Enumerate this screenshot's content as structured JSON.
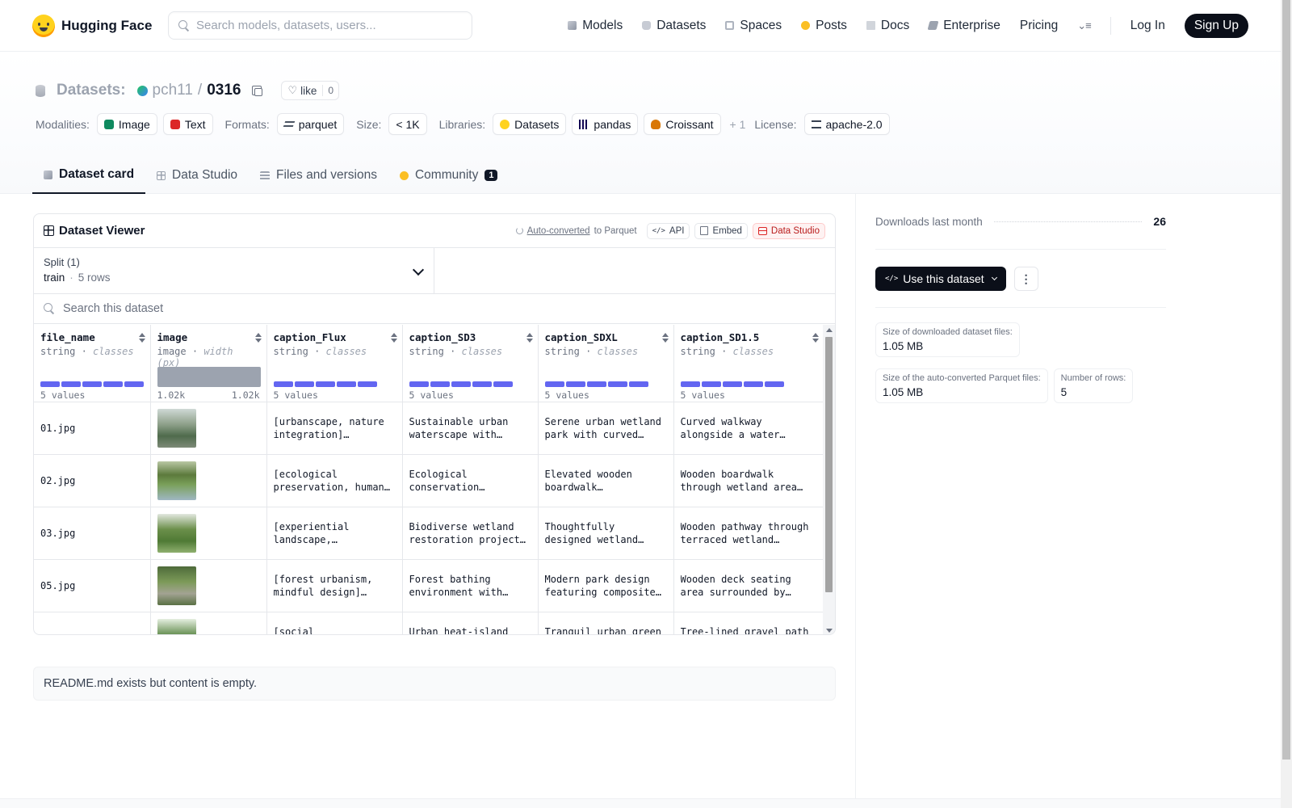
{
  "nav": {
    "brand": "Hugging Face",
    "search_placeholder": "Search models, datasets, users...",
    "links": [
      {
        "label": "Models",
        "icon": "models-icon"
      },
      {
        "label": "Datasets",
        "icon": "datasets-icon"
      },
      {
        "label": "Spaces",
        "icon": "spaces-icon"
      },
      {
        "label": "Posts",
        "icon": "posts-icon"
      },
      {
        "label": "Docs",
        "icon": "docs-icon"
      },
      {
        "label": "Enterprise",
        "icon": "enterprise-icon"
      },
      {
        "label": "Pricing"
      }
    ],
    "login": "Log In",
    "signup": "Sign Up"
  },
  "repo": {
    "type_label": "Datasets:",
    "owner": "pch11",
    "separator": "/",
    "name": "0316",
    "like_label": "like",
    "like_count": "0"
  },
  "tags": {
    "modalities_label": "Modalities:",
    "modalities": [
      "Image",
      "Text"
    ],
    "formats_label": "Formats:",
    "format": "parquet",
    "size_label": "Size:",
    "size": "< 1K",
    "libraries_label": "Libraries:",
    "libraries": [
      "Datasets",
      "pandas",
      "Croissant"
    ],
    "libraries_more": "+ 1",
    "license_label": "License:",
    "license": "apache-2.0"
  },
  "tabs": [
    {
      "label": "Dataset card",
      "active": true
    },
    {
      "label": "Data Studio"
    },
    {
      "label": "Files and versions"
    },
    {
      "label": "Community",
      "badge": "1"
    }
  ],
  "viewer": {
    "title": "Dataset Viewer",
    "autoconverted_link": "Auto-converted",
    "autoconverted_suffix": "to Parquet",
    "api": "API",
    "embed": "Embed",
    "data_studio": "Data Studio",
    "split_label": "Split (1)",
    "split_value": "train",
    "split_dot": "·",
    "split_rows": "5 rows",
    "search_placeholder": "Search this dataset",
    "columns": [
      {
        "name": "file_name",
        "type": "string",
        "kind": "classes",
        "footer": "5 values"
      },
      {
        "name": "image",
        "type": "image",
        "kind": "width (px)",
        "footer_min": "1.02k",
        "footer_max": "1.02k"
      },
      {
        "name": "caption_Flux",
        "type": "string",
        "kind": "classes",
        "footer": "5 values"
      },
      {
        "name": "caption_SD3",
        "type": "string",
        "kind": "classes",
        "footer": "5 values"
      },
      {
        "name": "caption_SDXL",
        "type": "string",
        "kind": "classes",
        "footer": "5 values"
      },
      {
        "name": "caption_SD1.5",
        "type": "string",
        "kind": "classes",
        "footer": "5 values"
      }
    ],
    "type_sep": " · ",
    "rows": [
      {
        "file_name": "01.jpg",
        "caption_Flux": "[urbanscape, nature integration] Circular…",
        "caption_SD3": "Sustainable urban waterscape with gentl…",
        "caption_SDXL": "Serene urban wetland park with curved…",
        "caption_SD15": "Curved walkway alongside a water…"
      },
      {
        "file_name": "02.jpg",
        "caption_Flux": "[ecological preservation, human…",
        "caption_SD3": "Ecological conservation wetland…",
        "caption_SDXL": "Elevated wooden boardwalk meandering…",
        "caption_SD15": "Wooden boardwalk through wetland area…"
      },
      {
        "file_name": "03.jpg",
        "caption_Flux": "[experiential landscape, biophilic…",
        "caption_SD3": "Biodiverse wetland restoration project…",
        "caption_SDXL": "Thoughtfully designed wetland garden with…",
        "caption_SD15": "Wooden pathway through terraced wetland…"
      },
      {
        "file_name": "05.jpg",
        "caption_Flux": "[forest urbanism, mindful design]…",
        "caption_SD3": "Forest bathing environment with…",
        "caption_SDXL": "Modern park design featuring composite…",
        "caption_SD15": "Wooden deck seating area surrounded by…"
      },
      {
        "file_name": "",
        "caption_Flux": "[social",
        "caption_SD3": "Urban heat-island",
        "caption_SDXL": "Tranquil urban green",
        "caption_SD15": "Tree-lined gravel path"
      }
    ]
  },
  "readme": "README.md exists but content is empty.",
  "sidebar": {
    "downloads_label": "Downloads last month",
    "downloads_value": "26",
    "use_button": "Use this dataset",
    "more": "⋮",
    "stats": [
      {
        "label": "Size of downloaded dataset files:",
        "value": "1.05 MB"
      },
      {
        "label": "Size of the auto-converted Parquet files:",
        "value": "1.05 MB"
      },
      {
        "label": "Number of rows:",
        "value": "5"
      }
    ]
  }
}
